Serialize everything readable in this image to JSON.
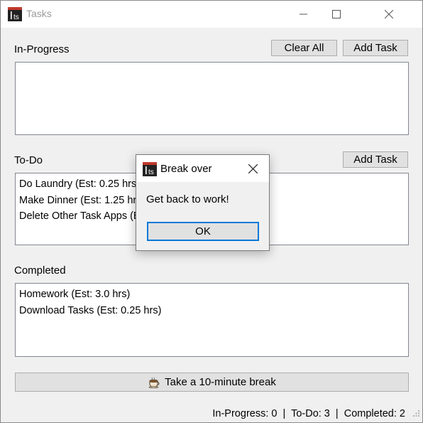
{
  "window": {
    "title": "Tasks",
    "app_icon": "ts-logo-icon"
  },
  "in_progress": {
    "label": "In-Progress",
    "clear_all_label": "Clear All",
    "add_task_label": "Add Task",
    "items": []
  },
  "todo": {
    "label": "To-Do",
    "add_task_label": "Add Task",
    "items": [
      "Do Laundry (Est: 0.25 hrs)",
      "Make Dinner (Est: 1.25 hrs)",
      "Delete Other Task Apps (Est: 0.5 hrs)"
    ]
  },
  "completed": {
    "label": "Completed",
    "items": [
      "Homework (Est: 3.0 hrs)",
      "Download Tasks (Est: 0.25 hrs)"
    ]
  },
  "break_button": {
    "label": "Take a 10-minute break",
    "icon": "coffee-cup-icon"
  },
  "status": {
    "text": "In-Progress: 0  |  To-Do: 3  |  Completed: 2"
  },
  "dialog": {
    "title": "Break over",
    "message": "Get back to work!",
    "ok_label": "OK"
  },
  "colors": {
    "window_bg": "#f0f0f0",
    "titlebar_bg": "#ffffff",
    "accent": "#0078d7",
    "logo_red": "#c0392b"
  }
}
